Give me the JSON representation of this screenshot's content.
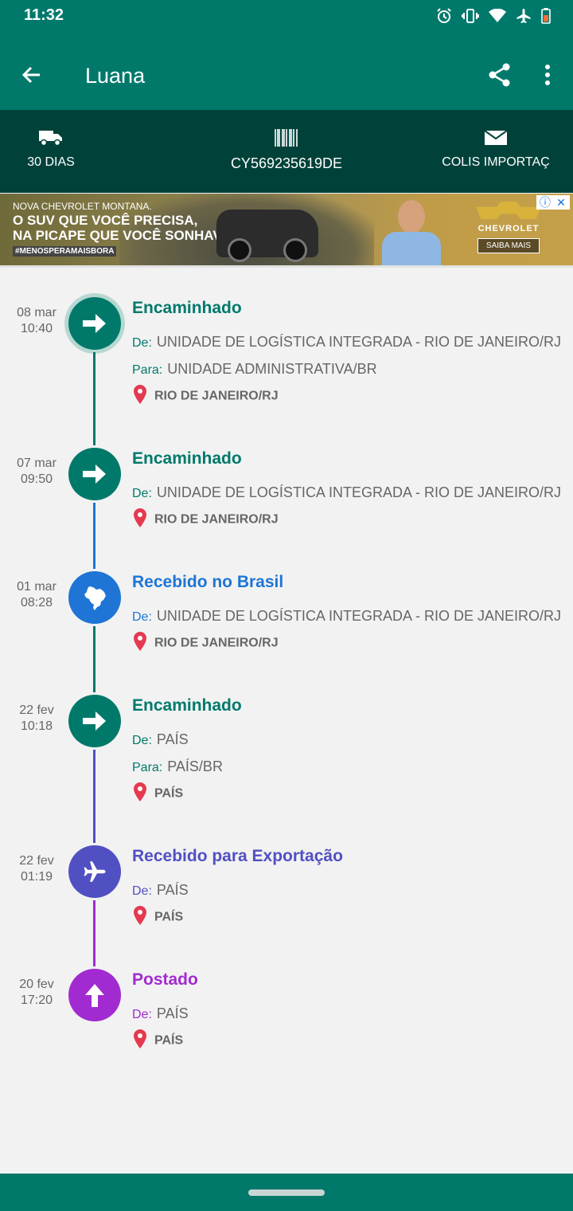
{
  "status_bar": {
    "time": "11:32",
    "icons": [
      "alarm-icon",
      "vibrate-icon",
      "wifi-icon",
      "airplane-icon",
      "battery-icon"
    ]
  },
  "app_bar": {
    "title": "Luana",
    "icons": [
      "back-arrow-icon",
      "share-icon",
      "more-vert-icon"
    ]
  },
  "info_bar": {
    "days": "30 DIAS",
    "tracking_code": "CY569235619DE",
    "shipment_type": "COLIS IMPORTAÇ"
  },
  "ad": {
    "line1": "NOVA CHEVROLET MONTANA.",
    "line2": "O SUV QUE VOCÊ PRECISA,",
    "line3": "NA PICAPE QUE VOCÊ SONHAVA.",
    "hashtag": "#MENOSPERAMAISBORA",
    "brand": "CHEVROLET",
    "cta": "SAIBA MAIS"
  },
  "colors": {
    "app_bar": "#00796b",
    "info_bar": "#00423a",
    "encaminhado": "#00796b",
    "recebido_brasil": "#1e75d5",
    "exportacao": "#5150c2",
    "postado": "#a12bd0",
    "pin": "#e53950"
  },
  "events": [
    {
      "date": "08 mar",
      "time": "10:40",
      "title": "Encaminhado",
      "icon": "arrow-right-icon",
      "color": "#00796b",
      "from_label": "De:",
      "from": "UNIDADE DE LOGÍSTICA INTEGRADA - RIO DE JANEIRO/RJ",
      "to_label": "Para:",
      "to": "UNIDADE ADMINISTRATIVA/BR",
      "location": "RIO DE JANEIRO/RJ"
    },
    {
      "date": "07 mar",
      "time": "09:50",
      "title": "Encaminhado",
      "icon": "arrow-right-icon",
      "color": "#00796b",
      "from_label": "De:",
      "from": "UNIDADE DE LOGÍSTICA INTEGRADA - RIO DE JANEIRO/RJ",
      "location": "RIO DE JANEIRO/RJ"
    },
    {
      "date": "01 mar",
      "time": "08:28",
      "title": "Recebido no Brasil",
      "icon": "brazil-map-icon",
      "color": "#1e75d5",
      "from_label": "De:",
      "from": "UNIDADE DE LOGÍSTICA INTEGRADA - RIO DE JANEIRO/RJ",
      "location": "RIO DE JANEIRO/RJ"
    },
    {
      "date": "22 fev",
      "time": "10:18",
      "title": "Encaminhado",
      "icon": "arrow-right-icon",
      "color": "#00796b",
      "from_label": "De:",
      "from": "PAÍS",
      "to_label": "Para:",
      "to": "PAÍS/BR",
      "location": "PAÍS"
    },
    {
      "date": "22 fev",
      "time": "01:19",
      "title": "Recebido para Exportação",
      "icon": "airplane-icon",
      "color": "#5150c2",
      "from_label": "De:",
      "from": "PAÍS",
      "location": "PAÍS"
    },
    {
      "date": "20 fev",
      "time": "17:20",
      "title": "Postado",
      "icon": "arrow-up-icon",
      "color": "#a12bd0",
      "from_label": "De:",
      "from": "PAÍS",
      "location": "PAÍS"
    }
  ]
}
